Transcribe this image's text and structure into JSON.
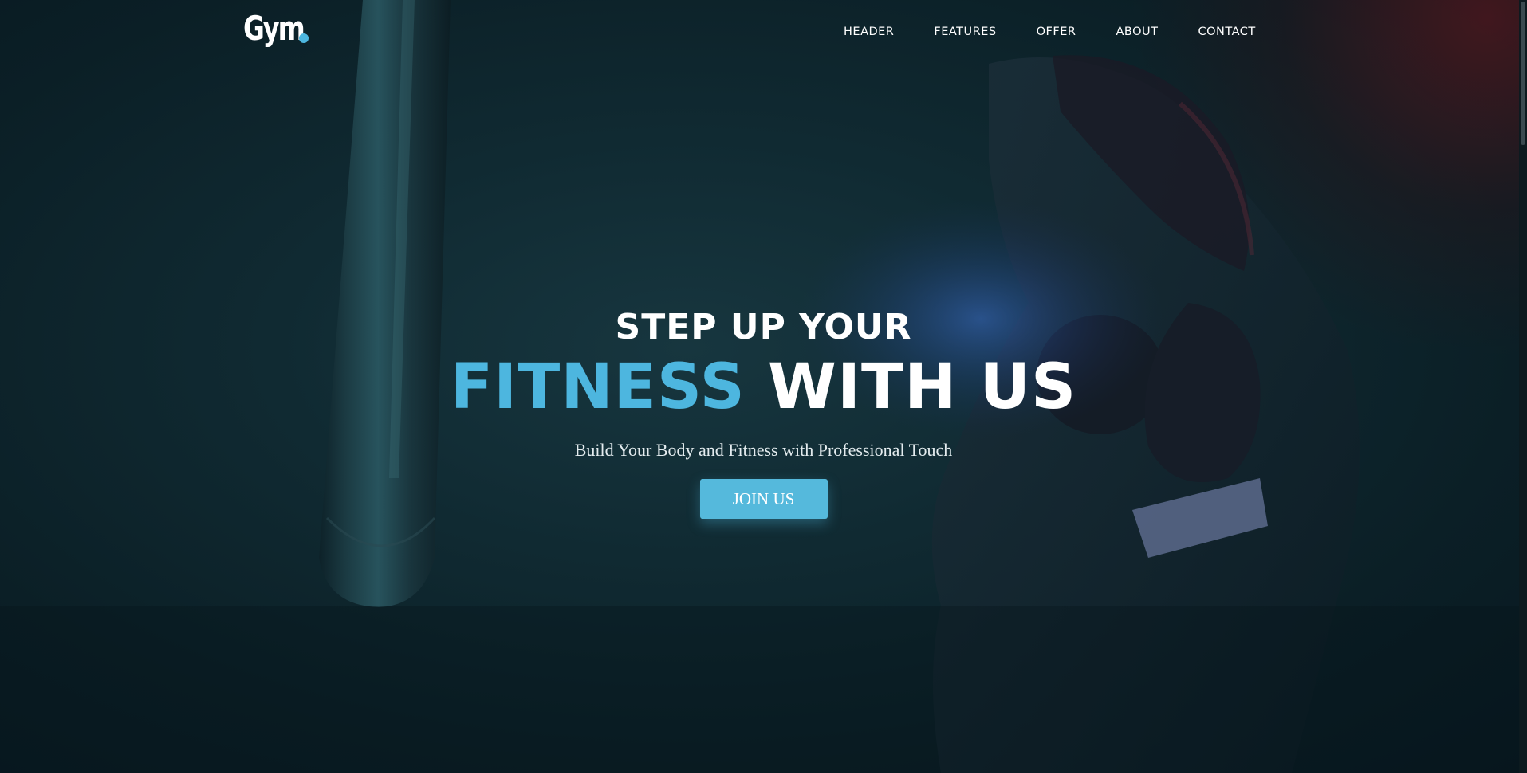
{
  "colors": {
    "accent": "#4db6df",
    "button": "#55b9dc",
    "background": "#0b1f26",
    "text": "#ffffff"
  },
  "header": {
    "logo_text": "Gym",
    "menu": [
      "HEADER",
      "FEATURES",
      "OFFER",
      "ABOUT",
      "CONTACT"
    ]
  },
  "hero": {
    "line1": "STEP UP YOUR",
    "line2_accent": "FITNESS",
    "line2_rest": "WITH US",
    "tagline": "Build Your Body and Fitness with Professional Touch",
    "cta_label": "JOIN US"
  },
  "background_image": {
    "subject": "boxer-with-punching-bag"
  }
}
